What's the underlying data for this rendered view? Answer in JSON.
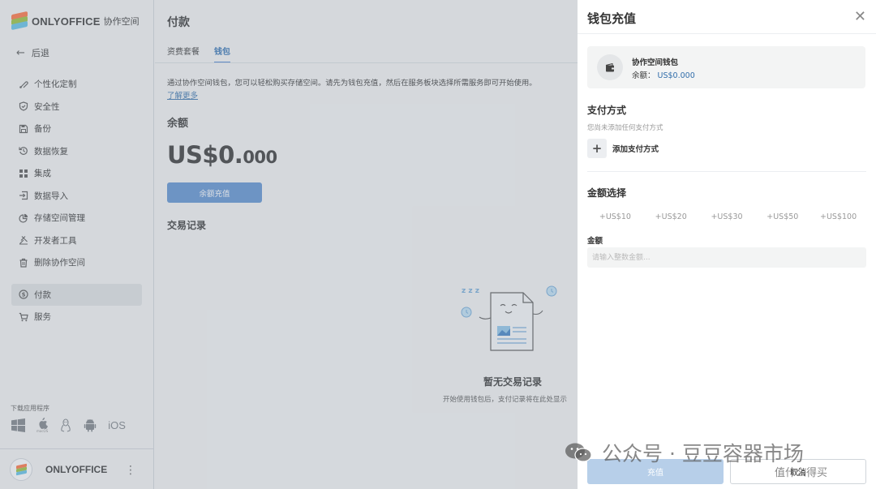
{
  "brand": {
    "name": "ONLYOFFICE",
    "subtitle": "协作空间"
  },
  "sidebar": {
    "back_label": "后退",
    "items": [
      {
        "label": "个性化定制",
        "icon": "paint-icon"
      },
      {
        "label": "安全性",
        "icon": "shield-icon"
      },
      {
        "label": "备份",
        "icon": "save-icon"
      },
      {
        "label": "数据恢复",
        "icon": "restore-icon"
      },
      {
        "label": "集成",
        "icon": "grid-icon"
      },
      {
        "label": "数据导入",
        "icon": "import-icon"
      },
      {
        "label": "存储空间管理",
        "icon": "pie-chart-icon"
      },
      {
        "label": "开发者工具",
        "icon": "developer-tools-icon"
      },
      {
        "label": "删除协作空间",
        "icon": "trash-icon"
      },
      {
        "label": "付款",
        "icon": "dollar-icon"
      },
      {
        "label": "服务",
        "icon": "cart-icon"
      }
    ],
    "active_item": "付款",
    "download_title": "下载应用程序",
    "download_apps": [
      "Windows",
      "macOS",
      "Linux",
      "Android",
      "iOS"
    ],
    "macos_caption": "macOS",
    "ios_label": "iOS",
    "profile_name": "ONLYOFFICE"
  },
  "main": {
    "title": "付款",
    "tabs": [
      {
        "label": "资费套餐",
        "active": false
      },
      {
        "label": "钱包",
        "active": true
      }
    ],
    "description": "通过协作空间钱包，您可以轻松购买存储空间。请先为钱包充值，然后在服务板块选择所需服务即可开始使用。",
    "learn_more": "了解更多",
    "balance_heading": "余额",
    "balance_main": "US$0.",
    "balance_decimals": "000",
    "topup_button": "余额充值",
    "transactions_heading": "交易记录",
    "empty_title": "暂无交易记录",
    "empty_subtitle": "开始使用钱包后，支付记录将在此处显示",
    "empty_zzz": "z z z"
  },
  "panel": {
    "title": "钱包充值",
    "wallet_name": "协作空间钱包",
    "wallet_balance_label": "余额：",
    "wallet_balance_value": "US$0.000",
    "payment_heading": "支付方式",
    "payment_note": "您尚未添加任何支付方式",
    "add_payment": "添加支付方式",
    "amount_heading": "金额选择",
    "amount_options": [
      "+US$10",
      "+US$20",
      "+US$30",
      "+US$50",
      "+US$100"
    ],
    "amount_label": "金额",
    "amount_placeholder": "请输入整数金额...",
    "submit_button": "充值",
    "cancel_button": "取消"
  },
  "watermark": {
    "text": "公众号 · 豆豆容器市场",
    "sub": "值什么得买"
  },
  "colors": {
    "accent": "#4781d1",
    "button": "#5b8fd0",
    "link": "#316daa",
    "sidebar_bg": "#f3f4f4"
  }
}
